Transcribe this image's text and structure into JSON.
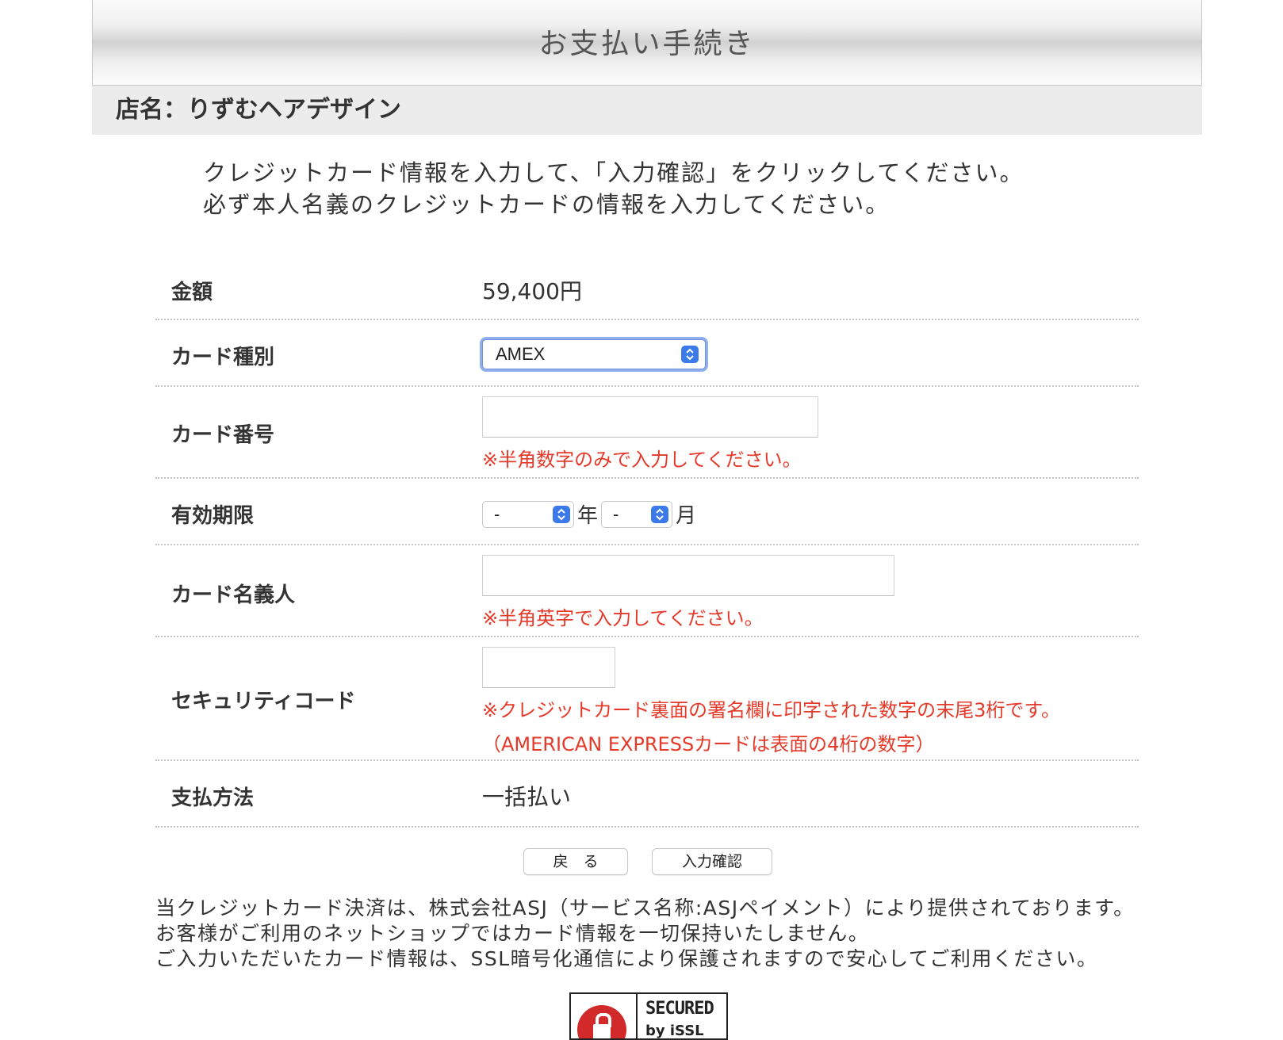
{
  "header": {
    "title": "お支払い手続き"
  },
  "shop": {
    "label": "店名：りずむヘアデザイン"
  },
  "instructions": {
    "line1": "クレジットカード情報を入力して、「入力確認」をクリックしてください。",
    "line2": "必ず本人名義のクレジットカードの情報を入力してください。"
  },
  "form": {
    "amount_label": "金額",
    "amount_value": "59,400円",
    "card_type_label": "カード種別",
    "card_type_value": "AMEX",
    "card_number_label": "カード番号",
    "card_number_value": "",
    "card_number_note": "※半角数字のみで入力してください。",
    "expiry_label": "有効期限",
    "expiry_year_value": "-",
    "expiry_year_unit": "年",
    "expiry_month_value": "-",
    "expiry_month_unit": "月",
    "holder_label": "カード名義人",
    "holder_value": "",
    "holder_note": "※半角英字で入力してください。",
    "security_label": "セキュリティコード",
    "security_value": "",
    "security_note1": "※クレジットカード裏面の署名欄に印字された数字の末尾3桁です。",
    "security_note2": "（AMERICAN EXPRESSカードは表面の4桁の数字）",
    "payment_method_label": "支払方法",
    "payment_method_value": "一括払い"
  },
  "buttons": {
    "back_label": "戻　る",
    "confirm_label": "入力確認"
  },
  "footer": {
    "line1": "当クレジットカード決済は、株式会社ASJ（サービス名称:ASJペイメント）により提供されております。",
    "line2": "お客様がご利用のネットショップではカード情報を一切保持いたしません。",
    "line3": "ご入力いただいたカード情報は、SSL暗号化通信により保護されますので安心してご利用ください。"
  },
  "seal": {
    "text": "SECURED",
    "sub": "by iSSL"
  },
  "colors": {
    "note_red": "#e53a2a",
    "focus_blue": "#3b7ae8",
    "header_bg": "#d2d2d2",
    "shop_bg": "#ececec"
  }
}
